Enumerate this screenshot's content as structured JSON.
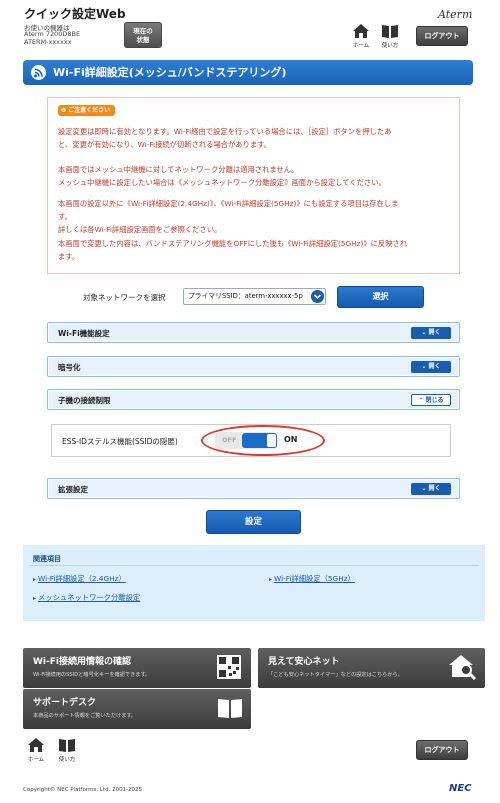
{
  "header": {
    "app_title": "クイック設定Web",
    "device_line1": "お使いの機器は",
    "device_line2": "Aterm 7200D8BE",
    "device_line3": "ATERM-xxxxxx",
    "status_button_line1": "現在の",
    "status_button_line2": "状態",
    "brand": "Aterm",
    "home_label": "ホーム",
    "help_label": "使い方",
    "logout_label": "ログアウト"
  },
  "page_title": "Wi-Fi詳細設定(メッシュ/バンドステアリング)",
  "caution": {
    "badge": "ご注意ください",
    "lines": [
      "設定変更は即時に有効となります。Wi-Fi経由で設定を行っている場合には、［設定］ボタンを押したあ",
      "と、変更が有効になり、Wi-Fi接続が切断される場合があります。",
      "本画面ではメッシュ中継機に対してネットワーク分離は適用されません。",
      "メッシュ中継機に設定したい場合は《メッシュネットワーク分離設定》画面から設定してください。",
      "本画面の設定以外に《Wi-Fi詳細設定(2.4GHz)》、《Wi-Fi詳細設定(5GHz)》にも設定する項目は存在しま",
      "す。",
      "詳しくは各Wi-Fi詳細設定画面をご参照ください。",
      "本画面で変更した内容は、バンドステアリング機能をOFFにした後も《Wi-Fi詳細設定(5GHz)》に反映され",
      "ます。"
    ]
  },
  "network_select": {
    "label": "対象ネットワークを選択",
    "value": "プライマリSSID：aterm-xxxxxx-5p",
    "button": "選択"
  },
  "sections": {
    "wifi_function": {
      "title": "Wi-Fi機能設定",
      "toggle": "開く"
    },
    "encryption": {
      "title": "暗号化",
      "toggle": "開く"
    },
    "client_limit": {
      "title": "子機の接続制限",
      "toggle": "閉じる"
    },
    "advanced": {
      "title": "拡張設定",
      "toggle": "開く"
    }
  },
  "ess_stealth": {
    "label": "ESS-IDステルス機能(SSIDの隠匿)",
    "off_text": "OFF",
    "on_text": "ON",
    "state": "ON"
  },
  "apply_button": "設定",
  "related": {
    "title": "関連項目",
    "links": [
      "Wi-Fi詳細設定（2.4GHz）",
      "Wi-Fi詳細設定（5GHz）",
      "メッシュネットワーク分離設定"
    ]
  },
  "tiles": {
    "wifi_info": {
      "title": "Wi-Fi接続用情報の確認",
      "desc": "Wi-Fi接続用のSSIDと暗号化キーを確認できます。"
    },
    "anshin": {
      "title": "見えて安心ネット",
      "desc": "「こども安心ネットタイマー」などの設定はこちらから。"
    },
    "support": {
      "title": "サポートデスク",
      "desc": "本商品のサポート情報をご覧いただけます。"
    }
  },
  "footer": {
    "home_label": "ホーム",
    "help_label": "使い方",
    "logout_label": "ログアウト",
    "copyright": "Copyright© NEC Platforms, Ltd. 2001-2025",
    "nec_logo": "NEC"
  },
  "colors": {
    "primary_blue": "#1a63b8",
    "caution_text": "#c23c2c",
    "caution_badge": "#f08a1c",
    "accordion_bg": "#e6f1fb",
    "related_bg": "#dceefa",
    "annotation_ring": "#e03a2a"
  }
}
